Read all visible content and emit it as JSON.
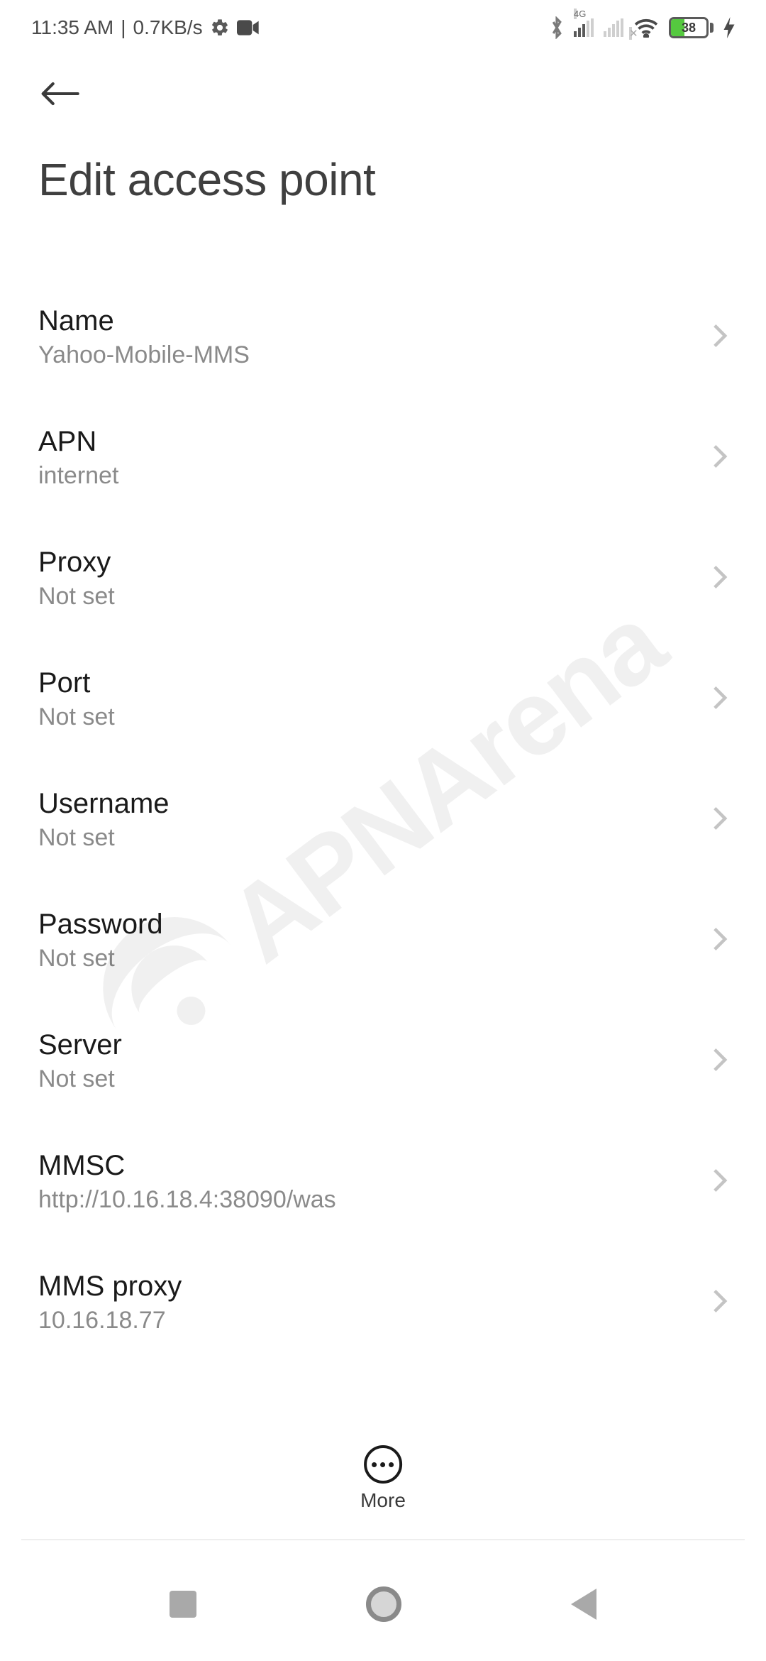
{
  "status_bar": {
    "time": "11:35 AM",
    "net_speed": "0.7KB/s",
    "signal_label": "4G",
    "battery_percent": "38"
  },
  "header": {
    "title": "Edit access point"
  },
  "settings": [
    {
      "label": "Name",
      "value": "Yahoo-Mobile-MMS"
    },
    {
      "label": "APN",
      "value": "internet"
    },
    {
      "label": "Proxy",
      "value": "Not set"
    },
    {
      "label": "Port",
      "value": "Not set"
    },
    {
      "label": "Username",
      "value": "Not set"
    },
    {
      "label": "Password",
      "value": "Not set"
    },
    {
      "label": "Server",
      "value": "Not set"
    },
    {
      "label": "MMSC",
      "value": "http://10.16.18.4:38090/was"
    },
    {
      "label": "MMS proxy",
      "value": "10.16.18.77"
    }
  ],
  "floating": {
    "more_label": "More"
  },
  "watermark": "APNArena"
}
